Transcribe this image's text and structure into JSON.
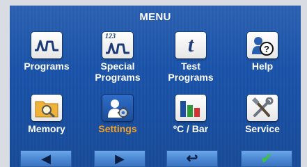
{
  "menu": {
    "title": "MENU"
  },
  "items": [
    {
      "label": "Programs"
    },
    {
      "label": "Special\nPrograms"
    },
    {
      "label": "Test\nPrograms"
    },
    {
      "label": "Help"
    },
    {
      "label": "Memory"
    },
    {
      "label": "Settings",
      "active": true
    },
    {
      "label": "ºC / Bar"
    },
    {
      "label": "Service"
    }
  ],
  "icons": {
    "programs": "program-curve-icon",
    "special": "special-programs-icon",
    "special_badge": "123",
    "test": "test-t-icon",
    "test_glyph": "t",
    "help": "help-user-icon",
    "memory": "memory-folder-icon",
    "settings": "settings-user-gear-icon",
    "units": "units-bar-chart-icon",
    "service": "service-tools-icon"
  },
  "nav": {
    "prev": "◀",
    "next": "▶",
    "back": "↩",
    "confirm": "✔"
  },
  "colors": {
    "background": "#1b52a6",
    "active_label": "#f3a12b",
    "confirm_green": "#3cc43c"
  }
}
